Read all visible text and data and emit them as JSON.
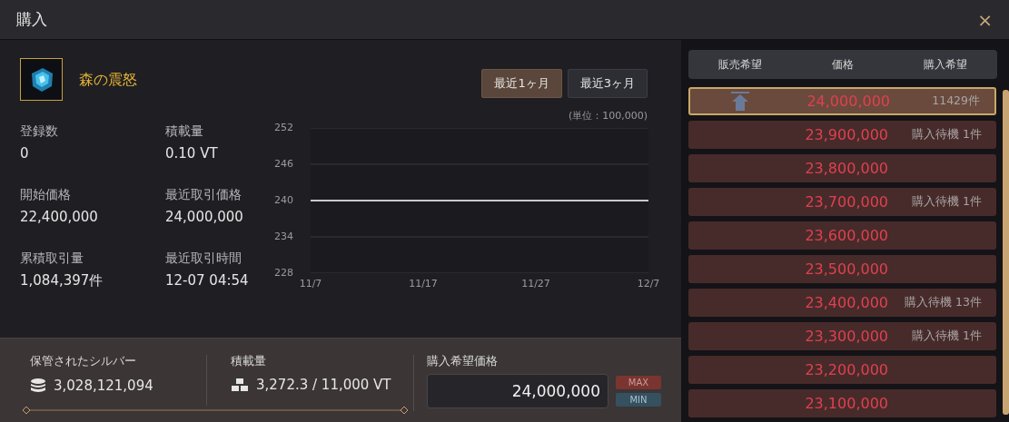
{
  "window": {
    "title": "購入",
    "close": "×"
  },
  "item": {
    "name": "森の震怒"
  },
  "period_tabs": [
    {
      "label": "最近1ヶ月",
      "selected": true
    },
    {
      "label": "最近3ヶ月",
      "selected": false
    }
  ],
  "stats": [
    {
      "label": "登録数",
      "value": "0"
    },
    {
      "label": "積載量",
      "value": "0.10 VT"
    },
    {
      "label": "開始価格",
      "value": "22,400,000"
    },
    {
      "label": "最近取引価格",
      "value": "24,000,000"
    },
    {
      "label": "累積取引量",
      "value": "1,084,397件"
    },
    {
      "label": "最近取引時間",
      "value": "12-07 04:54"
    }
  ],
  "chart": {
    "unit": "(単位：100,000)",
    "chart_data": {
      "type": "line",
      "x": [
        "11/7",
        "11/17",
        "11/27",
        "12/7"
      ],
      "ylim": [
        228,
        252
      ],
      "yticks": [
        252,
        246,
        240,
        234,
        228
      ],
      "series": [
        {
          "color": "#ffffff",
          "values": [
            240,
            240,
            240,
            240
          ]
        }
      ]
    }
  },
  "order_table": {
    "columns": [
      "販売希望",
      "価格",
      "購入希望"
    ],
    "rows": [
      {
        "price": "24,000,000",
        "orders": "11429件",
        "marker": true,
        "selected": true
      },
      {
        "price": "23,900,000",
        "orders": "購入待機 1件",
        "marker": false,
        "selected": false
      },
      {
        "price": "23,800,000",
        "marker": false,
        "selected": false
      },
      {
        "price": "23,700,000",
        "orders": "購入待機 1件",
        "marker": false,
        "selected": false
      },
      {
        "price": "23,600,000",
        "marker": false,
        "selected": false
      },
      {
        "price": "23,500,000",
        "marker": false,
        "selected": false
      },
      {
        "price": "23,400,000",
        "orders": "購入待機 13件",
        "marker": false,
        "selected": false
      },
      {
        "price": "23,300,000",
        "orders": "購入待機 1件",
        "marker": false,
        "selected": false
      },
      {
        "price": "23,200,000",
        "marker": false,
        "selected": false
      },
      {
        "price": "23,100,000",
        "marker": false,
        "selected": false
      }
    ]
  },
  "footer": {
    "silver_label": "保管されたシルバー",
    "silver_value": "3,028,121,094",
    "weight_label": "積載量",
    "weight_value": "3,272.3 / 11,000 VT",
    "price_label": "購入希望価格",
    "price_value": "24,000,000",
    "max": "MAX",
    "min": "MIN"
  }
}
